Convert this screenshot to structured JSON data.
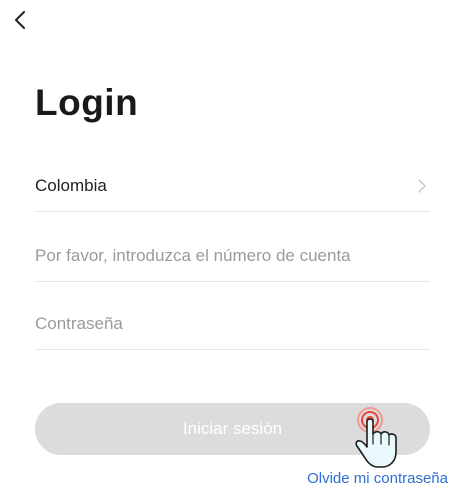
{
  "header": {
    "back_icon": "chevron-left-icon"
  },
  "main": {
    "title": "Login",
    "country": {
      "value": "Colombia",
      "icon": "chevron-right-icon"
    },
    "account": {
      "placeholder": "Por favor, introduzca el número de cuenta",
      "value": ""
    },
    "password": {
      "placeholder": "Contraseña",
      "value": ""
    },
    "login_button": "Iniciar sesión",
    "forgot_link": "Olvide mi contraseña",
    "tap_hint_icon": "hand-pointer-icon"
  },
  "colors": {
    "button_disabled": "#dcdcdc",
    "link": "#2f6fd6",
    "placeholder": "#9b9b9b",
    "hand_fill": "#e9f8fb",
    "tap_ring": "#e8453c"
  }
}
